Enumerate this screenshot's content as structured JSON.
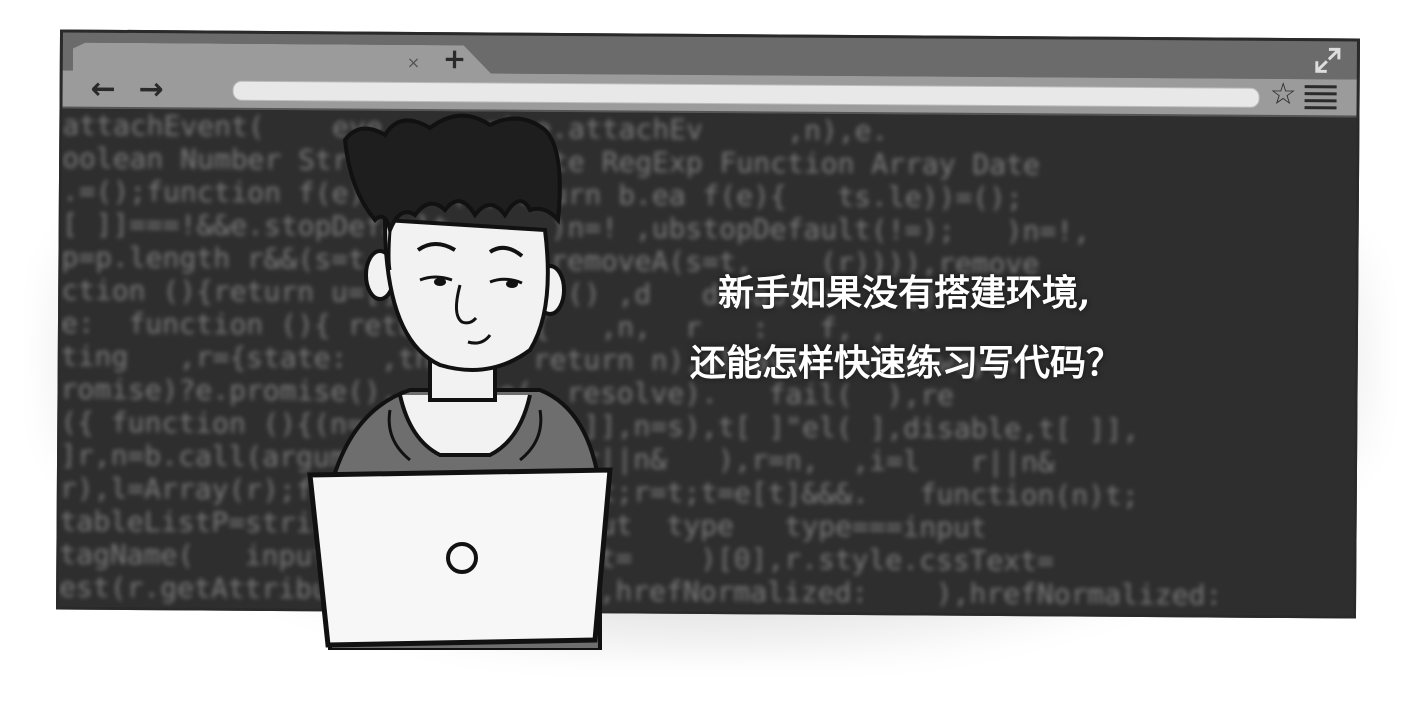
{
  "browser": {
    "tab_close_glyph": "×",
    "new_tab_glyph": "+",
    "back_glyph": "←",
    "forward_glyph": "→",
    "star_glyph": "☆",
    "icons": [
      "close-window-icon",
      "minimize-window-icon",
      "maximize-window-icon",
      "expand-icon",
      "star-icon",
      "menu-icon"
    ]
  },
  "background_code": [
    "attachEvent(    eve     ,n),e.attachEv     ,n),e.",
    "oolean Number String Array Date RegExp Function Array Date",
    ".=();function f(e){   =();return b.ea f(e){   ts.le))=();",
    "[ ]]===!&&e.stopDefault      )n=! ,ubstopDefault(!=);   )n=!,",
    "p=p.length r&&(s=t     this),removeA(s=t,    (r)))),remove",
    "ction (){return u=[]  able:   () ,d   disable:    ()",
    "e:  function (){ return    ({   ,n,  r   :   f, ,",
    "ting   ,r={state:  ,then:   return n),always:  n),always:",
    "romise)?e.promise().   done(  resolve).   fail(  ),re",
    "({ function (){(n=s)   able,t[ ]],n=s),t[ ]\"el( ],disable,t[ ]],",
    "]r,n=b.call(arguments   ,i=l   r||n&   ),r=n,  ,i=l   r||n&",
    "r),l=Array(r);for(   function(n)t;r=t;t=e[t]&&&.   function(n)t;",
    "tableListP=string   type===  input  type   type===input",
    "tagName(   input   ,e=        ext=    )[0],r.style.cssText=",
    "est(r.getAttribute( style      ),hrefNormalized:    ),hrefNormalized:"
  ],
  "headline": {
    "line1": "新手如果没有搭建环境,",
    "line2": "还能怎样快速练习写代码？"
  }
}
